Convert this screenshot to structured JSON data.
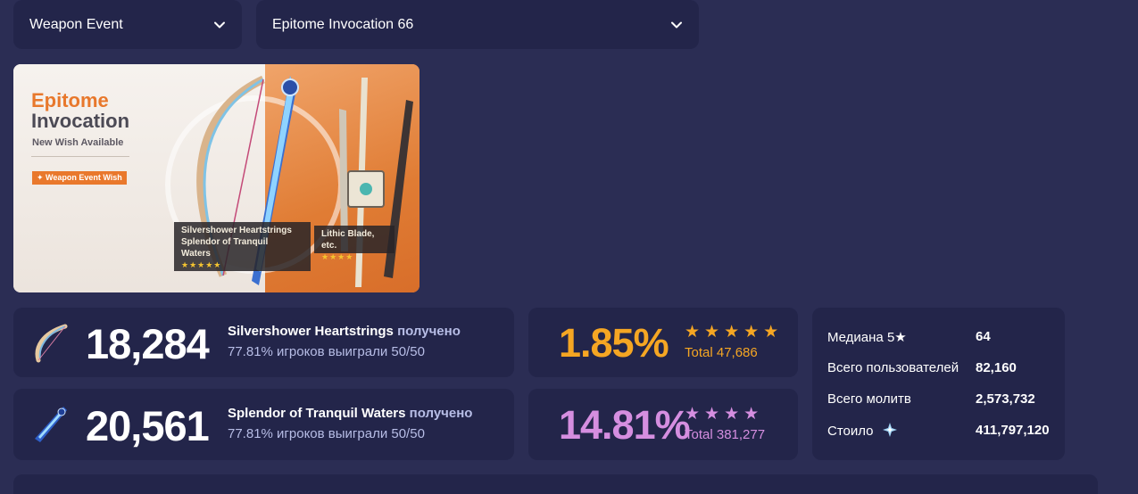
{
  "filters": {
    "type_selected": "Weapon Event",
    "banner_selected": "Epitome Invocation 66"
  },
  "banner": {
    "title_line1": "Epitome",
    "title_line2": "Invocation",
    "subtitle": "New Wish Available",
    "tag": "✦ Weapon Event Wish",
    "card1_line1": "Silvershower Heartstrings",
    "card1_line2": "Splendor of Tranquil",
    "card1_line3": "Waters",
    "card1_stars": "★★★★★",
    "card2_line1": "Lithic Blade, etc.",
    "card2_stars": "★★★★"
  },
  "weapons": [
    {
      "count": "18,284",
      "name": "Silvershower Heartstrings",
      "received": "получено",
      "win_text": "77.81% игроков выиграли 50/50"
    },
    {
      "count": "20,561",
      "name": "Splendor of Tranquil Waters",
      "received": "получено",
      "win_text": "77.81% игроков выиграли 50/50"
    }
  ],
  "rates": {
    "five_star": {
      "percent": "1.85%",
      "stars": "★★★★★",
      "total": "Total 47,686",
      "color": "#f5a623"
    },
    "four_star": {
      "percent": "14.81%",
      "stars": "★★★★",
      "total": "Total 381,277",
      "color": "#d58ee0"
    }
  },
  "stats": {
    "median_label": "Медиана 5★",
    "median_value": "64",
    "users_label": "Всего пользователей",
    "users_value": "82,160",
    "wishes_label": "Всего молитв",
    "wishes_value": "2,573,732",
    "cost_label": "Стоило",
    "cost_icon": "primogem-icon",
    "cost_value": "411,797,120"
  }
}
